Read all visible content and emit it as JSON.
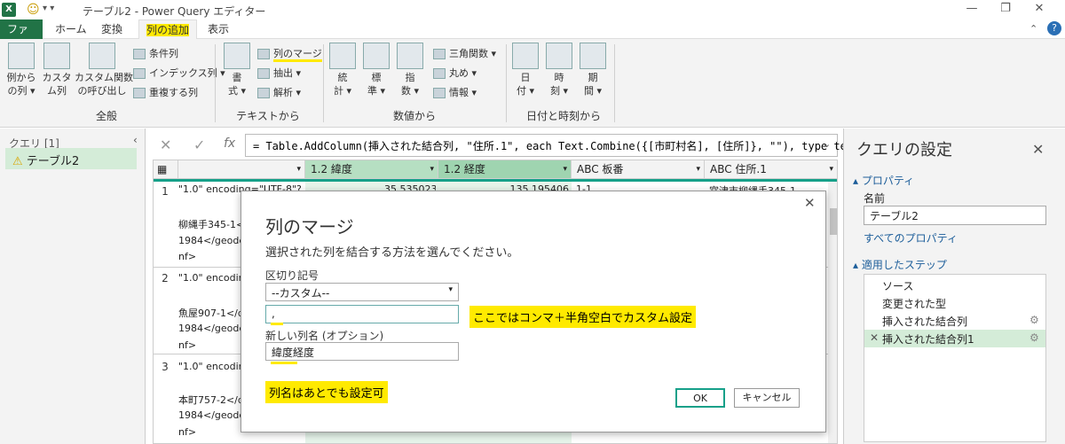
{
  "titlebar": {
    "title": "テーブル2 - Power Query エディター"
  },
  "tabs": [
    {
      "label": "ファイル"
    },
    {
      "label": "ホーム"
    },
    {
      "label": "変換"
    },
    {
      "label": "列の追加"
    },
    {
      "label": "表示"
    }
  ],
  "ribbon": {
    "general": {
      "group": "全般",
      "btn1": "例から\nの列 ▾",
      "btn2": "カスタ\nム列",
      "btn3": "カスタム関数\nの呼び出し",
      "small": [
        "条件列",
        "インデックス列 ▾",
        "重複する列"
      ]
    },
    "text": {
      "group": "テキストから",
      "btn1": "書\n式 ▾",
      "small": [
        "列のマージ",
        "抽出 ▾",
        "解析 ▾"
      ]
    },
    "number": {
      "group": "数値から",
      "btns": [
        "統\n計 ▾",
        "標\n準 ▾",
        "指\n数 ▾"
      ],
      "small": [
        "三角関数 ▾",
        "丸め ▾",
        "情報 ▾"
      ]
    },
    "datetime": {
      "group": "日付と時刻から",
      "btns": [
        "日\n付 ▾",
        "時\n刻 ▾",
        "期\n間 ▾"
      ]
    }
  },
  "queries": {
    "header": "クエリ [1]",
    "item": "テーブル2"
  },
  "formula": "= Table.AddColumn(挿入された結合列, \"住所.1\", each Text.Combine({[市町村名], [住所]}, \"\"), type text)",
  "grid": {
    "columns": [
      "1.2  緯度",
      "1.2  経度",
      "ABC  板番",
      "ABC  住所.1"
    ],
    "rows": [
      {
        "num": "1",
        "lines": [
          "\"1.0\" encoding=\"UTF-8\"?>",
          "柳縄手345-1</",
          "1984</geodeti",
          "nf>"
        ],
        "lat": "35.535023",
        "lon": "135.195406",
        "ban": "1-1",
        "addr": "宮津市柳縄手345-1"
      },
      {
        "num": "2",
        "lines": [
          "\"1.0\" encoding=",
          "魚屋907-1</q",
          "1984</geodeti",
          "nf>"
        ]
      },
      {
        "num": "3",
        "lines": [
          "\"1.0\" encoding=",
          "本町757-2</q",
          "1984</geodeti",
          "nf>"
        ]
      }
    ]
  },
  "settings": {
    "title": "クエリの設定",
    "properties": "プロパティ",
    "name_label": "名前",
    "name_value": "テーブル2",
    "all_props": "すべてのプロパティ",
    "steps_header": "適用したステップ",
    "steps": [
      "ソース",
      "変更された型",
      "挿入された結合列",
      "挿入された結合列1"
    ]
  },
  "dialog": {
    "title": "列のマージ",
    "description": "選択された列を結合する方法を選んでください。",
    "separator_label": "区切り記号",
    "separator_value": "--カスタム--",
    "custom_value": ",",
    "newname_label": "新しい列名 (オプション)",
    "newname_value": "緯度経度",
    "note1": "ここではコンマ＋半角空白でカスタム設定",
    "note2": "列名はあとでも設定可",
    "ok": "OK",
    "cancel": "キャンセル"
  }
}
